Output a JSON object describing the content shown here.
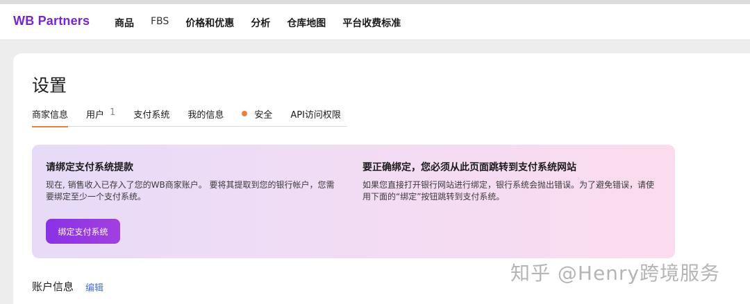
{
  "header": {
    "brand": "WB Partners",
    "nav": [
      {
        "label": "商品"
      },
      {
        "label": "FBS"
      },
      {
        "label": "价格和优惠"
      },
      {
        "label": "分析"
      },
      {
        "label": "仓库地图"
      },
      {
        "label": "平台收费标准"
      }
    ]
  },
  "page": {
    "title": "设置"
  },
  "tabs": [
    {
      "label": "商家信息",
      "active": true
    },
    {
      "label": "用户",
      "count": "1"
    },
    {
      "label": "支付系统"
    },
    {
      "label": "我的信息"
    },
    {
      "label": "安全",
      "indicator": true
    },
    {
      "label": "API访问权限"
    }
  ],
  "banner": {
    "left": {
      "heading": "请绑定支付系统提款",
      "text": "现在, 销售收入已存入了您的WB商家账户。 要将其提取到您的银行帐户，您需要绑定至少一个支付系统。",
      "button_label": "绑定支付系统"
    },
    "right": {
      "heading": "要正确绑定，您必须从此页面跳转到支付系统网站",
      "text": "如果您直接打开银行网站进行绑定，银行系统会抛出错误。为了避免错误，请使用下面的“绑定”按钮跳转到支付系统。"
    }
  },
  "account": {
    "title": "账户信息",
    "edit_label": "编辑"
  },
  "watermark": "知乎 @Henry跨境服务",
  "colors": {
    "brand": "#7a24c9",
    "accent": "#f07b3f",
    "button": "#8a31e6",
    "link": "#4a6fd8"
  }
}
